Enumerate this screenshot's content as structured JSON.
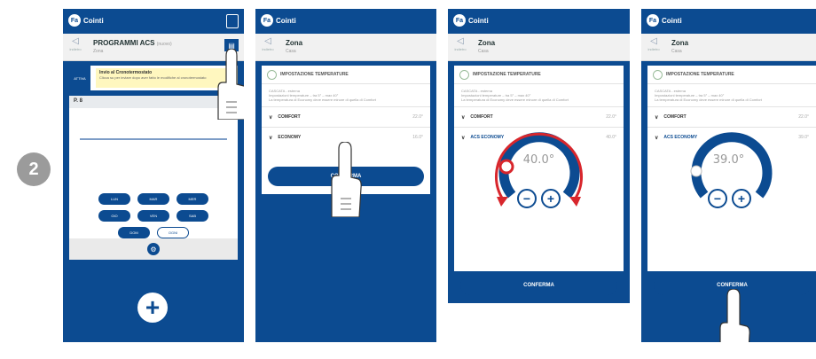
{
  "step": {
    "number": "2"
  },
  "app": {
    "brand": "Cointi"
  },
  "screen1": {
    "title": "PROGRAMMI ACS",
    "title_suffix": "(nuovo)",
    "subtitle": "Zona",
    "back_label": "indietro",
    "notice_left": "ATTIVA",
    "notice_title": "Invio al Cronotermostato",
    "notice_text": "Clicca su per inviare dopo aver fatto le modifiche al cronotermostato",
    "program_label": "P. 8",
    "days": [
      "LUN",
      "MAR",
      "MER",
      "GIO",
      "VEN",
      "SAB"
    ],
    "day_dom": "DOM",
    "day_ogni": "OGNI",
    "fab_label": "+"
  },
  "screen_common": {
    "title": "Zona",
    "subtitle": "Casa",
    "back_label": "indietro",
    "section_title": "IMPOSTAZIONE TEMPERATURE",
    "desc_line1": "CASCATA - esterna",
    "desc_line2": "Impostazioni temperature – tra 5° – max 40°",
    "desc_line3": "La temperatura di Economy deve essere minore di quella di Comfort",
    "row1_label": "COMFORT",
    "row1_value": "22.0°",
    "confirm_label": "CONFERMA"
  },
  "screen2": {
    "row2_label": "ECONOMY",
    "row2_value": "16.0°"
  },
  "screen3": {
    "row2_label": "ACS ECONOMY",
    "row2_value": "40.0°",
    "dial_value": "40.0°",
    "dial_fraction": 0.95
  },
  "screen4": {
    "row2_label": "ACS ECONOMY",
    "row2_value": "39.0°",
    "dial_value": "39.0°",
    "dial_fraction": 0.05
  },
  "colors": {
    "brand_blue": "#0c4b91",
    "accent_red": "#d8262c",
    "notice_yellow": "#fff7bf"
  }
}
